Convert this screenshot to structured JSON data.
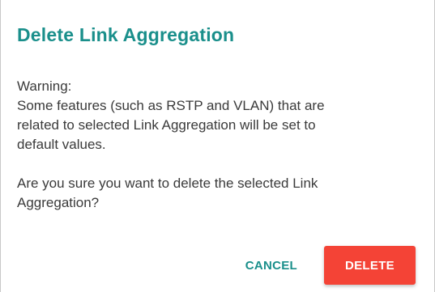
{
  "colors": {
    "accent": "#1a8f8b",
    "danger": "#f44336"
  },
  "dialog": {
    "title": "Delete Link Aggregation",
    "warning_label": "Warning:",
    "warning_lines": [
      "Some features (such as RSTP and VLAN) that are",
      "related to selected Link Aggregation will be set to",
      "default values."
    ],
    "question_lines": [
      "Are you sure you want to delete the selected Link",
      "Aggregation?"
    ],
    "cancel_label": "CANCEL",
    "delete_label": "DELETE"
  }
}
